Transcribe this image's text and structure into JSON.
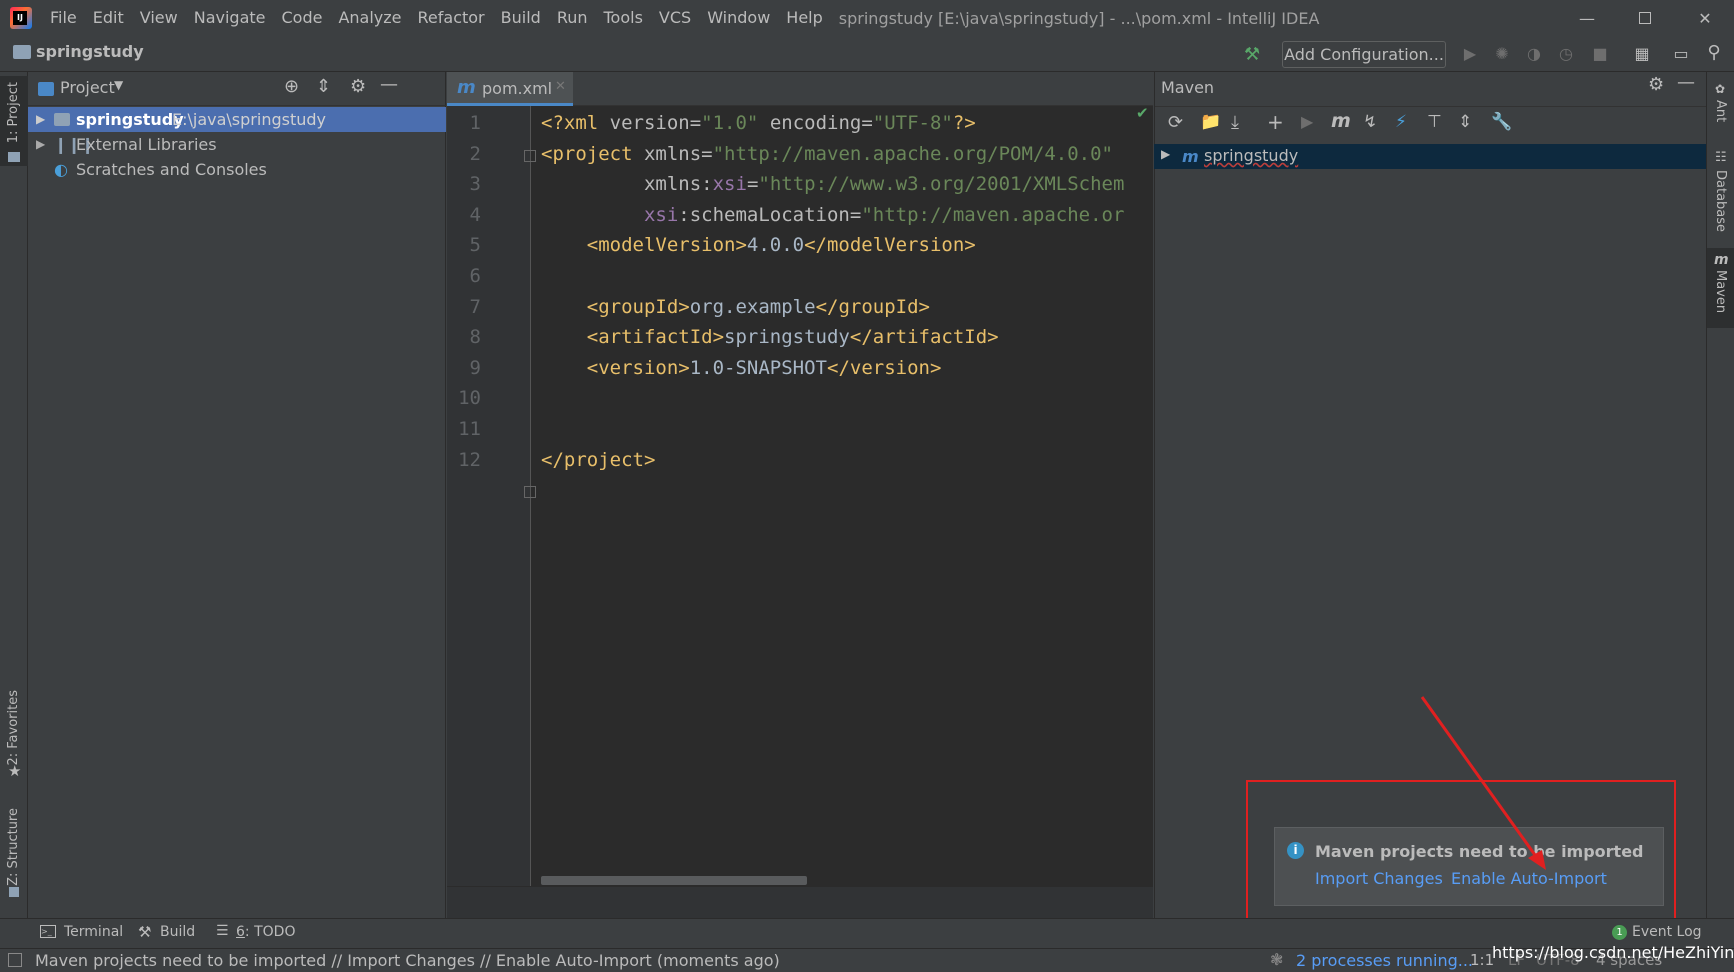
{
  "title_bar": {
    "menu": [
      "File",
      "Edit",
      "View",
      "Navigate",
      "Code",
      "Analyze",
      "Refactor",
      "Build",
      "Run",
      "Tools",
      "VCS",
      "Window",
      "Help"
    ],
    "window_title": "springstudy [E:\\java\\springstudy] - ...\\pom.xml - IntelliJ IDEA",
    "controls": [
      "minimize",
      "maximize",
      "close"
    ]
  },
  "nav_bar": {
    "project_name": "springstudy",
    "add_configuration": "Add Configuration..."
  },
  "left_stripe": {
    "tabs": [
      "1: Project",
      "2: Favorites",
      "Z: Structure"
    ]
  },
  "project_panel": {
    "title": "Project",
    "tree": [
      {
        "label": "springstudy",
        "path": "E:\\java\\springstudy",
        "selected": true
      },
      {
        "label": "External Libraries",
        "path": ""
      },
      {
        "label": "Scratches and Consoles",
        "path": ""
      }
    ]
  },
  "editor": {
    "tab": {
      "label": "pom.xml",
      "icon": "m"
    },
    "line_numbers": [
      "1",
      "2",
      "3",
      "4",
      "5",
      "6",
      "7",
      "8",
      "9",
      "10",
      "11",
      "12"
    ],
    "lines": [
      [
        [
          "tag",
          "<?xml "
        ],
        [
          "attr",
          "version"
        ],
        [
          "attr",
          "="
        ],
        [
          "str",
          "\"1.0\""
        ],
        [
          "attr",
          " encoding"
        ],
        [
          "attr",
          "="
        ],
        [
          "str",
          "\"UTF-8\""
        ],
        [
          "tag",
          "?>"
        ]
      ],
      [
        [
          "tag",
          "<project "
        ],
        [
          "attr",
          "xmlns"
        ],
        [
          "attr",
          "="
        ],
        [
          "str",
          "\"http://maven.apache.org/POM/4.0.0\""
        ]
      ],
      [
        [
          "attr",
          "         xmlns"
        ],
        [
          "attr",
          ":"
        ],
        [
          "ns",
          "xsi"
        ],
        [
          "attr",
          "="
        ],
        [
          "str",
          "\"http://www.w3.org/2001/XMLSchem"
        ]
      ],
      [
        [
          "ns",
          "         xsi"
        ],
        [
          "attr",
          ":schemaLocation="
        ],
        [
          "str",
          "\"http://maven.apache.or"
        ]
      ],
      [
        [
          "tag",
          "    <modelVersion>"
        ],
        [
          "text",
          "4.0.0"
        ],
        [
          "tag",
          "</modelVersion>"
        ]
      ],
      [],
      [
        [
          "tag",
          "    <groupId>"
        ],
        [
          "text",
          "org.example"
        ],
        [
          "tag",
          "</groupId>"
        ]
      ],
      [
        [
          "tag",
          "    <artifactId>"
        ],
        [
          "text",
          "springstudy"
        ],
        [
          "tag",
          "</artifactId>"
        ]
      ],
      [
        [
          "tag",
          "    <version>"
        ],
        [
          "text",
          "1.0-SNAPSHOT"
        ],
        [
          "tag",
          "</version>"
        ]
      ],
      [],
      [],
      [
        [
          "tag",
          "</project>"
        ]
      ]
    ]
  },
  "maven_panel": {
    "title": "Maven",
    "tree_root": "springstudy"
  },
  "right_stripe": {
    "tabs": [
      "Ant",
      "Database",
      "Maven"
    ]
  },
  "notification": {
    "title": "Maven projects need to be imported",
    "actions": [
      "Import Changes",
      "Enable Auto-Import"
    ]
  },
  "bottom_tabs": {
    "terminal": "Terminal",
    "build": "Build",
    "todo_prefix": "6",
    "todo_label": ": TODO",
    "event_log_count": "1",
    "event_log": "Event Log"
  },
  "status_bar": {
    "message": "Maven projects need to be imported // Import Changes // Enable Auto-Import (moments ago)",
    "processes": "2 processes running...",
    "position": "1:1",
    "line_sep": "LF",
    "encoding": "UTF-8",
    "indent": "4 spaces",
    "watermark": "https://blog.csdn.net/HeZhiYing_"
  },
  "colors": {
    "background": "#3c3f41",
    "editor_bg": "#2b2b2b",
    "selection": "#4b6eaf",
    "link": "#589df6",
    "highlight_box": "#e02020"
  }
}
